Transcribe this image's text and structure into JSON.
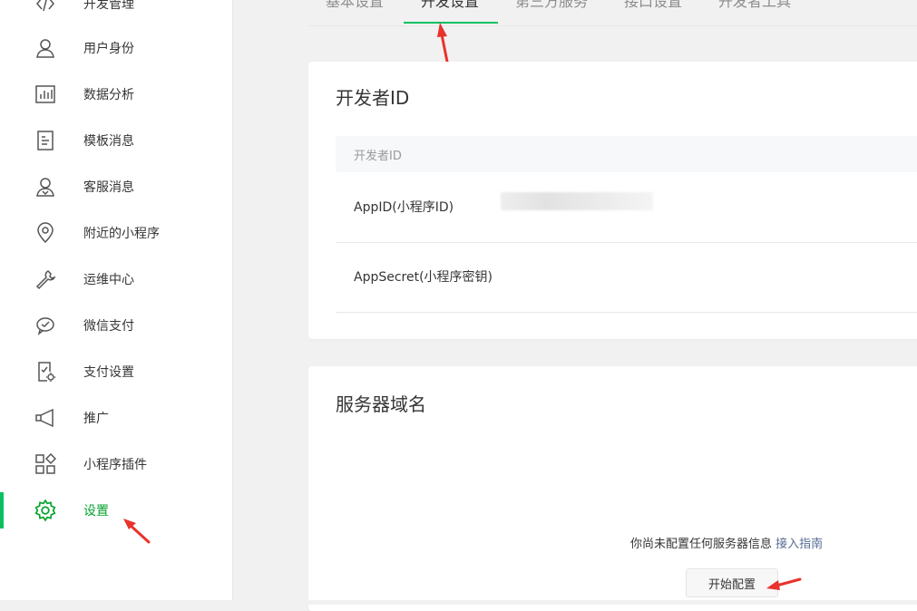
{
  "sidebar": {
    "items": [
      {
        "label": "开发管理",
        "icon": "code-icon"
      },
      {
        "label": "用户身份",
        "icon": "user-icon"
      },
      {
        "label": "数据分析",
        "icon": "chart-icon"
      },
      {
        "label": "模板消息",
        "icon": "document-icon"
      },
      {
        "label": "客服消息",
        "icon": "customer-service-icon"
      },
      {
        "label": "附近的小程序",
        "icon": "location-pin-icon"
      },
      {
        "label": "运维中心",
        "icon": "wrench-icon"
      },
      {
        "label": "微信支付",
        "icon": "wechat-pay-icon"
      },
      {
        "label": "支付设置",
        "icon": "payment-settings-icon"
      },
      {
        "label": "推广",
        "icon": "megaphone-icon"
      },
      {
        "label": "小程序插件",
        "icon": "plugin-grid-icon"
      },
      {
        "label": "设置",
        "icon": "gear-icon",
        "active": true
      }
    ]
  },
  "tabs": [
    {
      "label": "基本设置"
    },
    {
      "label": "开发设置",
      "active": true
    },
    {
      "label": "第三方服务"
    },
    {
      "label": "接口设置"
    },
    {
      "label": "开发者工具"
    }
  ],
  "developer_id": {
    "title": "开发者ID",
    "table_header": "开发者ID",
    "rows": [
      {
        "label": "AppID(小程序ID)"
      },
      {
        "label": "AppSecret(小程序密钥)"
      }
    ]
  },
  "server_domain": {
    "title": "服务器域名",
    "empty_text": "你尚未配置任何服务器信息",
    "guide_link": "接入指南",
    "config_button": "开始配置"
  },
  "colors": {
    "accent": "#07c160",
    "active_text": "#07a32e",
    "link": "#576b95",
    "annotation_arrow": "#e8322b"
  }
}
